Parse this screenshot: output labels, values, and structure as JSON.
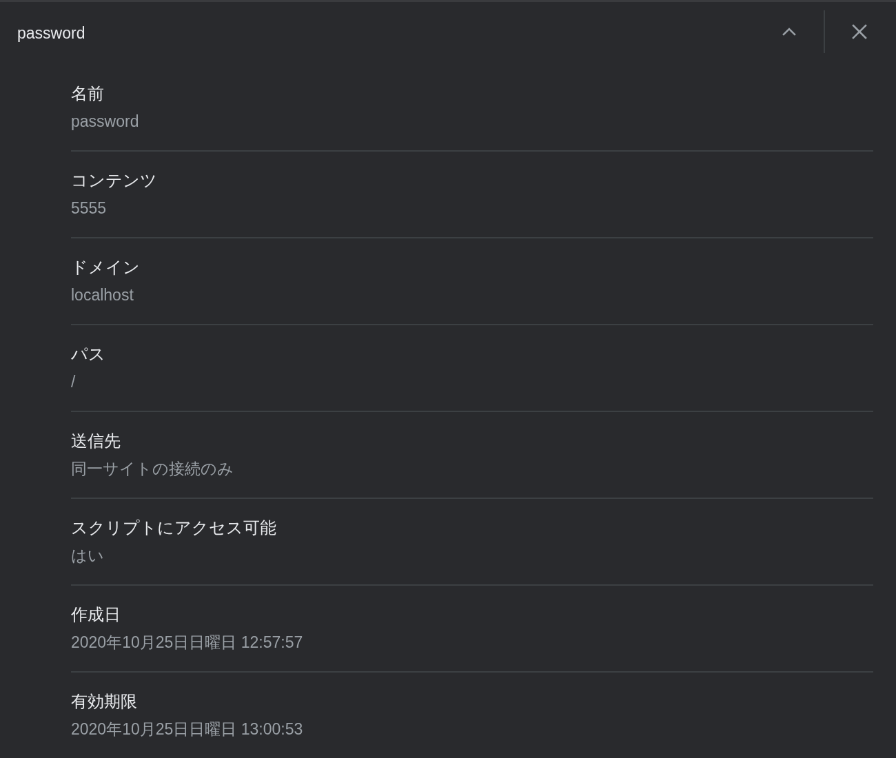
{
  "header": {
    "title": "password",
    "expanded": true
  },
  "fields": [
    {
      "label": "名前",
      "value": "password"
    },
    {
      "label": "コンテンツ",
      "value": "5555"
    },
    {
      "label": "ドメイン",
      "value": "localhost"
    },
    {
      "label": "パス",
      "value": "/"
    },
    {
      "label": "送信先",
      "value": "同一サイトの接続のみ"
    },
    {
      "label": "スクリプトにアクセス可能",
      "value": "はい"
    },
    {
      "label": "作成日",
      "value": "2020年10月25日日曜日 12:57:57"
    },
    {
      "label": "有効期限",
      "value": "2020年10月25日日曜日 13:00:53"
    }
  ]
}
